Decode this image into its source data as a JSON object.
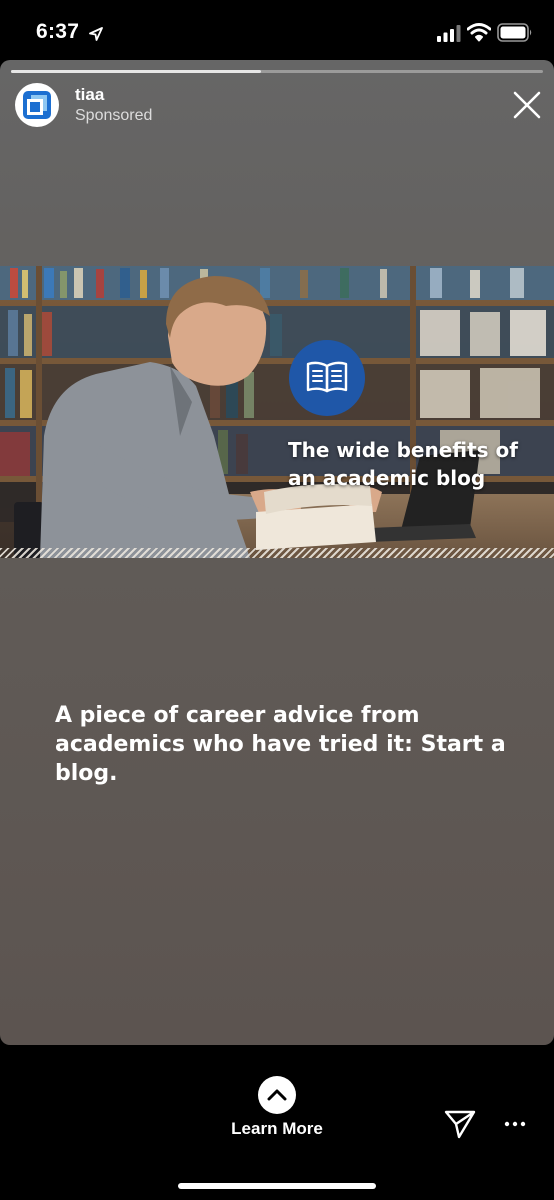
{
  "status_bar": {
    "time": "6:37"
  },
  "story": {
    "progress_fraction": 0.47,
    "account": {
      "name": "tiaa",
      "label": "Sponsored"
    },
    "ad_image": {
      "caption": "The wide benefits of an academic blog",
      "badge_icon": "open-book-icon"
    },
    "headline": "A piece of career advice from academics who have tried it: Start a blog."
  },
  "bottom_bar": {
    "cta_label": "Learn More",
    "cta_icon": "chevron-up-icon",
    "share_icon": "send-icon",
    "more_icon": "more-icon"
  },
  "colors": {
    "badge_blue": "#1f57a8",
    "card_top": "#666666",
    "card_bottom": "#5c5450"
  }
}
